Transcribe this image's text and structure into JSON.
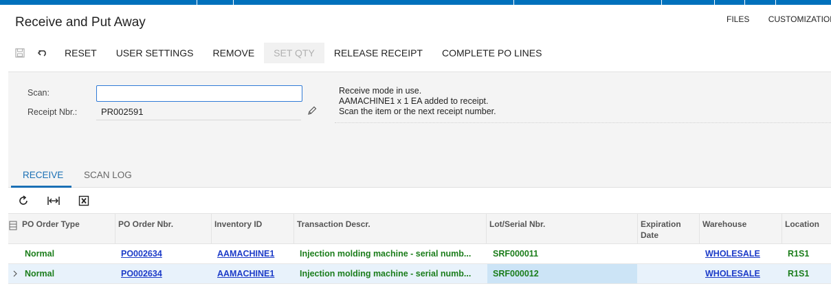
{
  "header": {
    "title": "Receive and Put Away",
    "links": [
      "FILES",
      "CUSTOMIZATION"
    ]
  },
  "toolbar": {
    "save_icon": "save-icon",
    "undo_icon": "undo-icon",
    "buttons": [
      "RESET",
      "USER SETTINGS",
      "REMOVE",
      "SET QTY",
      "RELEASE RECEIPT",
      "COMPLETE PO LINES"
    ],
    "disabled_button": "SET QTY"
  },
  "form": {
    "scan_label": "Scan:",
    "scan_value": "",
    "receipt_label": "Receipt Nbr.:",
    "receipt_value": "PR002591",
    "messages": [
      "Receive mode in use.",
      "AAMACHINE1 x 1 EA added to receipt.",
      "Scan the item or the next receipt number."
    ]
  },
  "tabs": [
    {
      "label": "RECEIVE",
      "active": true
    },
    {
      "label": "SCAN LOG",
      "active": false
    }
  ],
  "grid": {
    "columns": [
      "PO Order Type",
      "PO Order Nbr.",
      "Inventory ID",
      "Transaction Descr.",
      "Lot/Serial Nbr.",
      "Expiration Date",
      "Warehouse",
      "Location"
    ],
    "rows": [
      [
        "Normal",
        "PO002634",
        "AAMACHINE1",
        "Injection molding machine - serial numb...",
        "SRF000011",
        "",
        "WHOLESALE",
        "R1S1"
      ],
      [
        "Normal",
        "PO002634",
        "AAMACHINE1",
        "Injection molding machine - serial numb...",
        "SRF000012",
        "",
        "WHOLESALE",
        "R1S1"
      ]
    ],
    "selected_row": 1
  },
  "colors": {
    "accent": "#0071bc",
    "link": "#1d3cc8",
    "status_green": "#1b7d1b"
  }
}
